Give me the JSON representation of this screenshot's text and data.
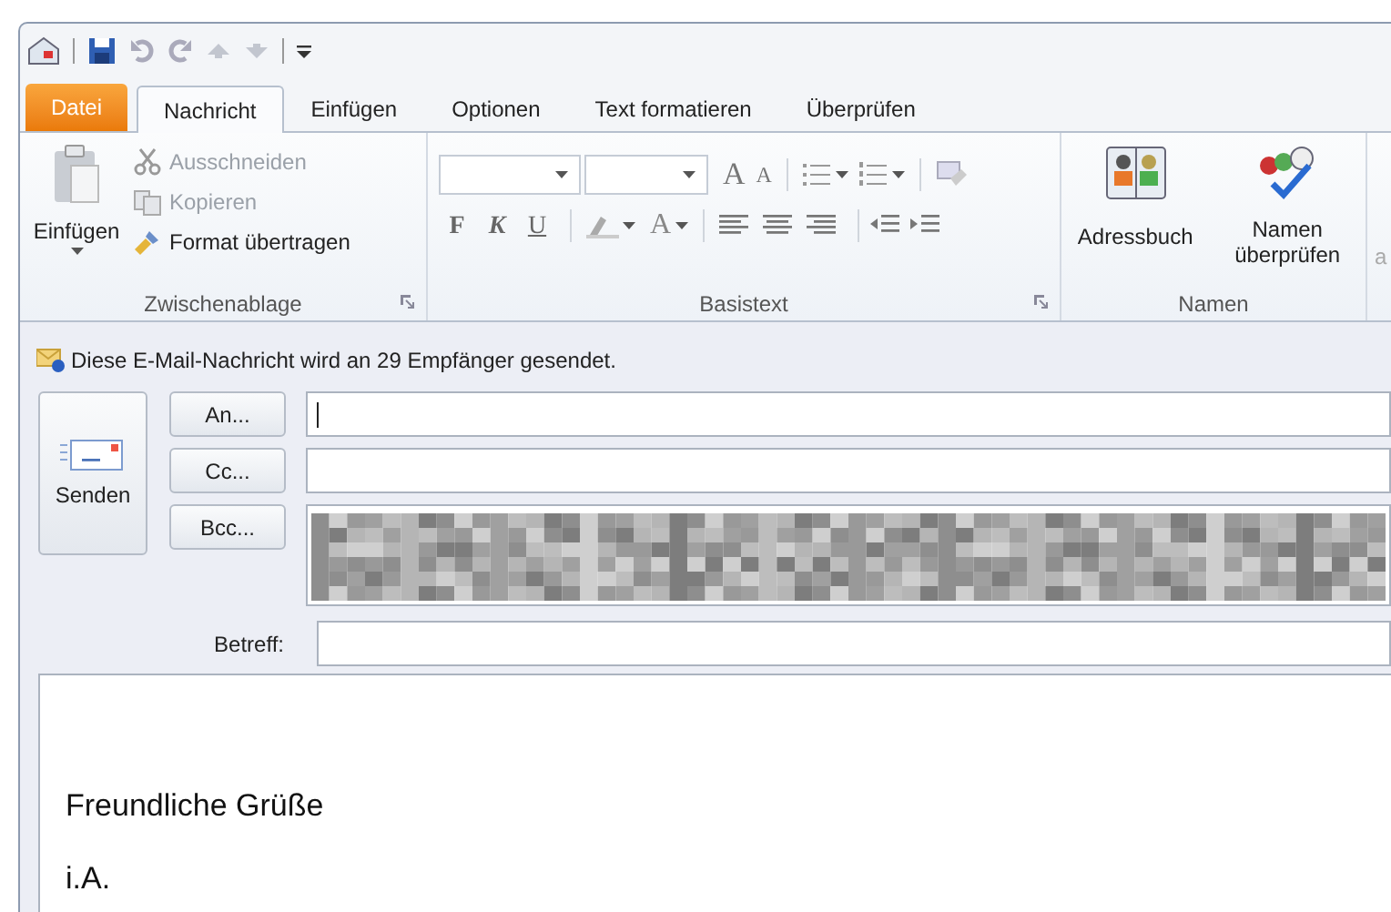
{
  "tabs": [
    {
      "label": "Datei",
      "kind": "file",
      "selected": false
    },
    {
      "label": "Nachricht",
      "kind": "tab",
      "selected": true
    },
    {
      "label": "Einfügen",
      "kind": "tab",
      "selected": false
    },
    {
      "label": "Optionen",
      "kind": "tab",
      "selected": false
    },
    {
      "label": "Text formatieren",
      "kind": "tab",
      "selected": false
    },
    {
      "label": "Überprüfen",
      "kind": "tab",
      "selected": false
    }
  ],
  "clipboard": {
    "paste": "Einfügen",
    "cut": {
      "label": "Ausschneiden",
      "disabled": true
    },
    "copy": {
      "label": "Kopieren",
      "disabled": true
    },
    "format_painter": {
      "label": "Format übertragen",
      "disabled": false
    },
    "group_label": "Zwischenablage"
  },
  "basic_text": {
    "grow_font": "A",
    "shrink_font": "A",
    "bold": "F",
    "italic": "K",
    "underline": "U",
    "font_color": "A",
    "group_label": "Basistext"
  },
  "names": {
    "address_book": "Adressbuch",
    "check_names": "Namen überprüfen",
    "group_label": "Namen"
  },
  "next_group_label": "a",
  "info_bar": "Diese E-Mail-Nachricht wird an 29 Empfänger gesendet.",
  "send_button": "Senden",
  "recipients": [
    {
      "button": "An...",
      "kind": "to"
    },
    {
      "button": "Cc...",
      "kind": "cc"
    },
    {
      "button": "Bcc...",
      "kind": "redacted"
    }
  ],
  "subject_label": "Betreff:",
  "body": [
    "Freundliche Grüße",
    "i.A."
  ]
}
